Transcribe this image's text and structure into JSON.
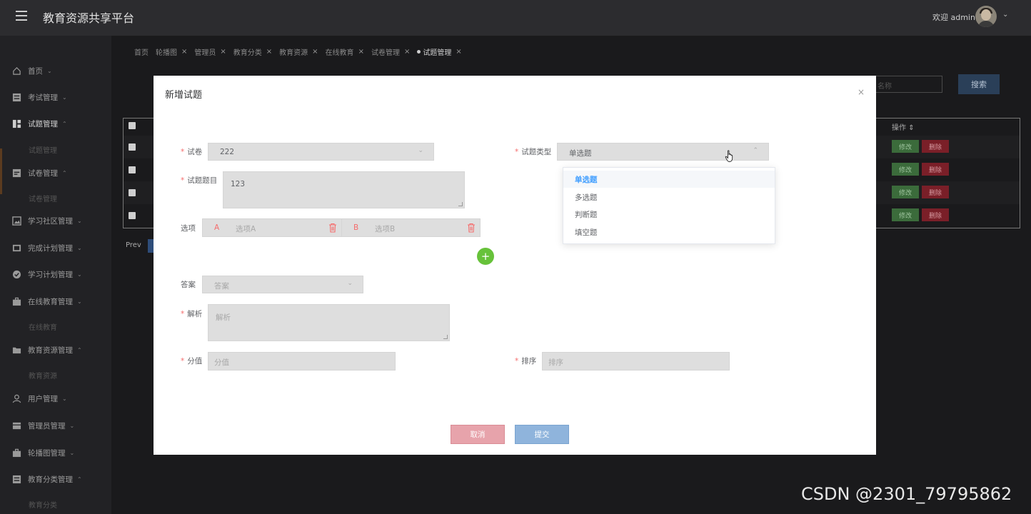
{
  "header": {
    "title": "教育资源共享平台",
    "welcome": "欢迎 admin"
  },
  "sidebar": {
    "items": [
      {
        "label": "首页",
        "icon": "home-icon"
      },
      {
        "label": "考试管理",
        "icon": "grid-icon"
      },
      {
        "label": "试题管理",
        "icon": "dashboard-icon"
      },
      {
        "label": "试卷管理",
        "icon": "list-icon"
      },
      {
        "label": "学习社区管理",
        "icon": "picture-icon"
      },
      {
        "label": "完成计划管理",
        "icon": "book-icon"
      },
      {
        "label": "学习计划管理",
        "icon": "check-circle-icon"
      },
      {
        "label": "在线教育管理",
        "icon": "briefcase-icon"
      },
      {
        "label": "教育资源管理",
        "icon": "folder-icon"
      },
      {
        "label": "用户管理",
        "icon": "user-icon"
      },
      {
        "label": "管理员管理",
        "icon": "box-icon"
      },
      {
        "label": "轮播图管理",
        "icon": "briefcase-icon"
      },
      {
        "label": "教育分类管理",
        "icon": "grid-icon"
      }
    ],
    "subs": [
      "试题管理",
      "试卷管理",
      "在线教育",
      "教育资源",
      "教育分类"
    ]
  },
  "tabs": [
    "首页",
    "轮播图",
    "管理员",
    "教育分类",
    "教育资源",
    "在线教育",
    "试卷管理",
    "试题管理"
  ],
  "toolbar": {
    "search_placeholder": "名称",
    "search_label": "搜索"
  },
  "table": {
    "op_header": "操作",
    "edit_label": "修改",
    "delete_label": "删除",
    "prev_label": "Prev"
  },
  "modal": {
    "title": "新增试题",
    "close": "×",
    "fields": {
      "paper": {
        "label": "试卷",
        "value": "222"
      },
      "type": {
        "label": "试题类型",
        "value": "单选题"
      },
      "question": {
        "label": "试题题目",
        "value": "123"
      },
      "options": {
        "label": "选项",
        "a_letter": "A",
        "a_placeholder": "选项A",
        "b_letter": "B",
        "b_placeholder": "选项B"
      },
      "answer": {
        "label": "答案",
        "placeholder": "答案"
      },
      "analysis": {
        "label": "解析",
        "placeholder": "解析"
      },
      "score": {
        "label": "分值",
        "placeholder": "分值"
      },
      "sort": {
        "label": "排序",
        "placeholder": "排序"
      }
    },
    "type_options": [
      "单选题",
      "多选题",
      "判断题",
      "填空题"
    ],
    "cancel_label": "取消",
    "submit_label": "提交"
  },
  "watermark": "CSDN @2301_79795862",
  "colors": {
    "required": "#f56c6c",
    "selected": "#409eff",
    "add": "#67c23a",
    "cancel": "#e7a3ab",
    "submit": "#8fb4dc"
  }
}
